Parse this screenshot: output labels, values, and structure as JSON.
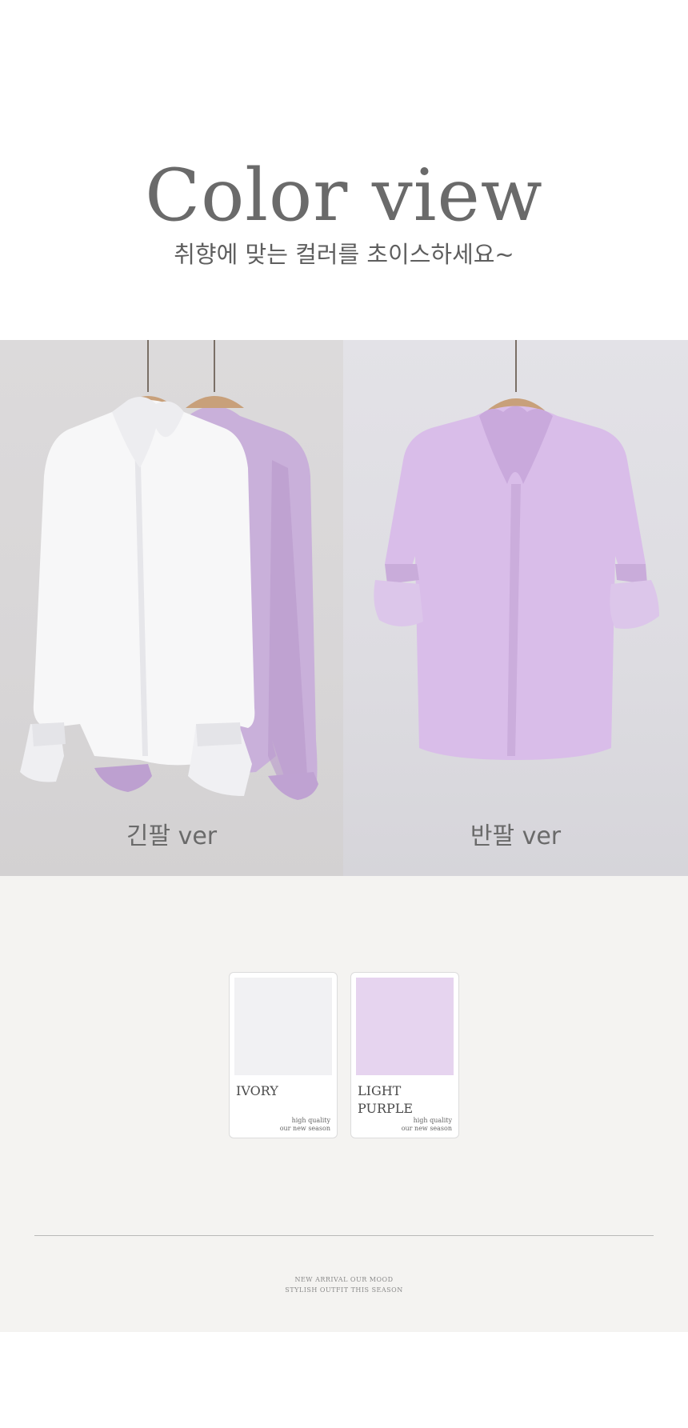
{
  "header": {
    "title": "Color view",
    "subtitle": "취향에 맞는 컬러를 초이스하세요~"
  },
  "photos": [
    {
      "caption": "긴팔 ver",
      "image": "ivory-and-lavender-long-sleeve-ruffle-blouses-on-hangers"
    },
    {
      "caption": "반팔 ver",
      "image": "lavender-short-sleeve-ruffle-blouse-on-hanger"
    }
  ],
  "swatches": [
    {
      "name": "IVORY",
      "color": "#f1f1f3",
      "tag_line1": "high quality",
      "tag_line2": "our new season"
    },
    {
      "name_line1": "LIGHT",
      "name_line2": "PURPLE",
      "color": "#e6d4ef",
      "tag_line1": "high quality",
      "tag_line2": "our new season"
    }
  ],
  "footer": {
    "line1": "NEW ARRIVAL OUR MOOD",
    "line2": "STYLISH OUTFIT THIS SEASON"
  }
}
